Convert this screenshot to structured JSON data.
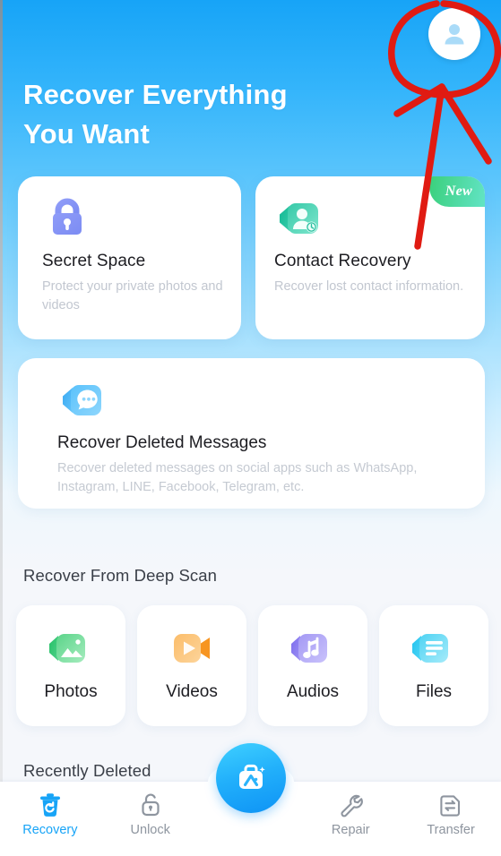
{
  "app": {
    "hero_title_line1": "Recover Everything",
    "hero_title_line2": "You Want",
    "accent_blue": "#17a4f7",
    "annotation_color": "#e01b12"
  },
  "header": {
    "avatar_name": "account-avatar"
  },
  "feature_cards": [
    {
      "id": "secret-space",
      "title": "Secret Space",
      "desc": "Protect your private photos and videos",
      "icon": "lock-icon",
      "badge": null
    },
    {
      "id": "contact-recovery",
      "title": "Contact Recovery",
      "desc": "Recover lost contact information.",
      "icon": "contact-clock-icon",
      "badge": "New"
    }
  ],
  "message_card": {
    "title": "Recover Deleted Messages",
    "desc": "Recover deleted messages on social apps such as WhatsApp, Instagram, LINE, Facebook, Telegram, etc.",
    "icon": "chat-bubble-icon"
  },
  "deep_scan": {
    "section_title": "Recover From Deep Scan",
    "tiles": [
      {
        "label": "Photos",
        "icon": "photo-icon",
        "color": "#4fd07f"
      },
      {
        "label": "Videos",
        "icon": "video-icon",
        "color": "#f7a94c"
      },
      {
        "label": "Audios",
        "icon": "music-icon",
        "color": "#9b8cf0"
      },
      {
        "label": "Files",
        "icon": "document-icon",
        "color": "#45cdf0"
      }
    ]
  },
  "recently_deleted": {
    "section_title": "Recently Deleted"
  },
  "bottom_nav": {
    "items": [
      {
        "label": "Recovery",
        "icon": "trash-restore-icon",
        "active": true
      },
      {
        "label": "Unlock",
        "icon": "open-padlock-icon",
        "active": false
      },
      {
        "label": "Repair",
        "icon": "wrench-icon",
        "active": false
      },
      {
        "label": "Transfer",
        "icon": "transfer-file-icon",
        "active": false
      }
    ],
    "fab": {
      "icon": "ai-toolbox-icon"
    }
  }
}
